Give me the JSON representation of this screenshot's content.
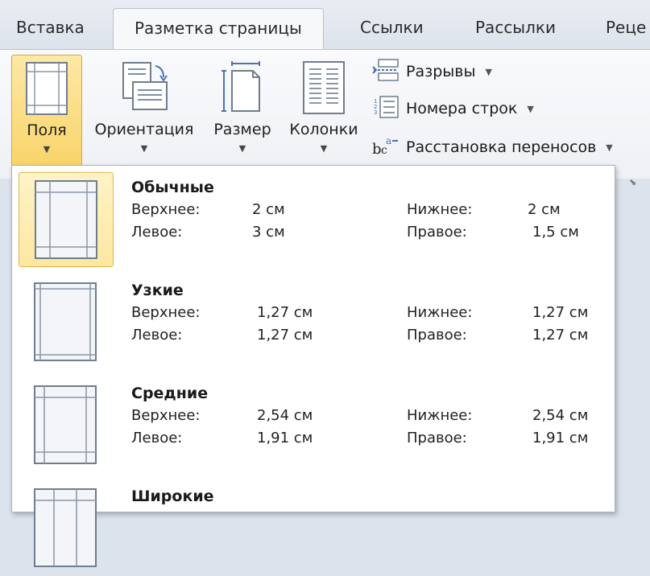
{
  "tabs": [
    {
      "label": "Вставка",
      "active": false
    },
    {
      "label": "Разметка страницы",
      "active": true
    },
    {
      "label": "Ссылки",
      "active": false
    },
    {
      "label": "Рассылки",
      "active": false
    },
    {
      "label": "Реце",
      "active": false
    }
  ],
  "ribbon": {
    "fields_label": "Поля",
    "orientation_label": "Ориентация",
    "size_label": "Размер",
    "columns_label": "Колонки",
    "breaks_label": "Разрывы",
    "line_numbers_label": "Номера строк",
    "hyphenation_label": "Расстановка переносов"
  },
  "margins_menu": {
    "presets": [
      {
        "name": "Обычные",
        "top_label": "Верхнее:",
        "top": "2 см",
        "bottom_label": "Нижнее:",
        "bottom": "2 см",
        "left_label": "Левое:",
        "left": "3 см",
        "right_label": "Правое:",
        "right": "1,5 см",
        "selected": true
      },
      {
        "name": "Узкие",
        "top_label": "Верхнее:",
        "top": "1,27 см",
        "bottom_label": "Нижнее:",
        "bottom": "1,27 см",
        "left_label": "Левое:",
        "left": "1,27 см",
        "right_label": "Правое:",
        "right": "1,27 см",
        "selected": false
      },
      {
        "name": "Средние",
        "top_label": "Верхнее:",
        "top": "2,54 см",
        "bottom_label": "Нижнее:",
        "bottom": "2,54 см",
        "left_label": "Левое:",
        "left": "1,91 см",
        "right_label": "Правое:",
        "right": "1,91 см",
        "selected": false
      },
      {
        "name": "Широкие",
        "selected": false
      }
    ]
  },
  "colors": {
    "accent_hover": "#f9d46a",
    "accent_border": "#d9a63a",
    "ribbon_bg": "#f4f6f9"
  }
}
